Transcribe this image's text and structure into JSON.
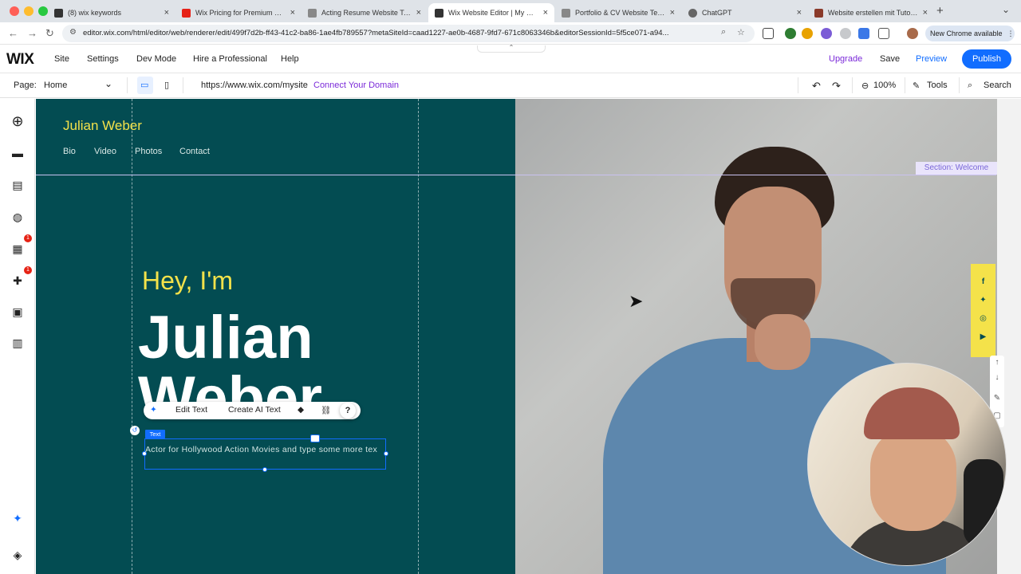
{
  "browser": {
    "tabs": [
      {
        "label": "(8) wix keywords",
        "color": "#333333"
      },
      {
        "label": "Wix Pricing for Premium Plans",
        "color": "#e62117"
      },
      {
        "label": "Acting Resume Website Temp",
        "color": "#222222"
      },
      {
        "label": "Wix Website Editor | My Site",
        "color": "#222222"
      },
      {
        "label": "Portfolio & CV Website Temp",
        "color": "#222222"
      },
      {
        "label": "ChatGPT",
        "color": "#555555"
      },
      {
        "label": "Website erstellen mit Tutorial",
        "color": "#8a3a2a"
      }
    ],
    "url": "editor.wix.com/html/editor/web/renderer/edit/499f7d2b-ff43-41c2-ba86-1ae4fb789557?metaSiteId=caad1227-ae0b-4687-9fd7-671c8063346b&editorSessionId=5f5ce071-a94...",
    "chrome_badge": "New Chrome available"
  },
  "wix": {
    "logo": "WIX",
    "menu": [
      "Site",
      "Settings",
      "Dev Mode",
      "Hire a Professional",
      "Help"
    ],
    "upgrade": "Upgrade",
    "save": "Save",
    "preview": "Preview",
    "publish": "Publish",
    "page_label": "Page:",
    "page_name": "Home",
    "site_url": "https://www.wix.com/mysite",
    "connect_domain": "Connect Your Domain",
    "zoom": "100%",
    "tools": "Tools",
    "search": "Search",
    "badges": [
      "1",
      "1"
    ]
  },
  "site": {
    "title": "Julian Weber",
    "nav": [
      "Bio",
      "Video",
      "Photos",
      "Contact"
    ],
    "greeting": "Hey, I'm",
    "name_line1": "Julian",
    "name_line2": "Weber",
    "body_text": "Actor for Hollywood Action Movies and type some more tex",
    "section_label": "Section: Welcome",
    "text_tag": "Text",
    "toolbar": {
      "edit_text": "Edit Text",
      "create_ai_text": "Create AI Text"
    }
  },
  "colors": {
    "site_bg": "#034c52",
    "accent_yellow": "#f4e24a",
    "wix_blue": "#116dff",
    "upgrade_purple": "#7b2ad9"
  }
}
